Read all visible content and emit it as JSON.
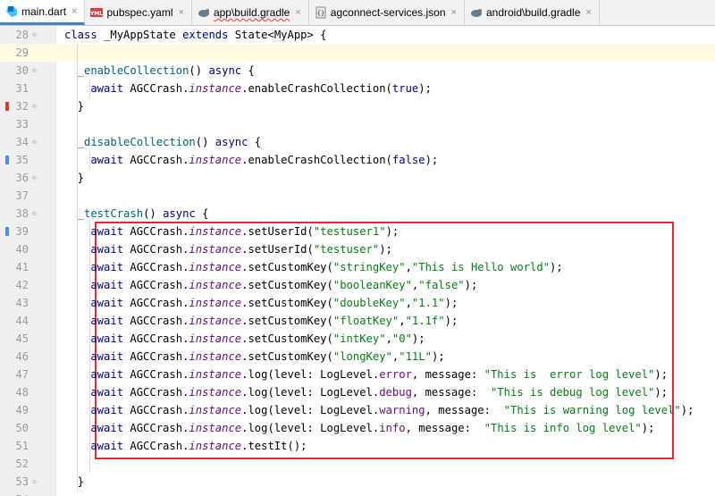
{
  "tabs": [
    {
      "label": "main.dart",
      "icon": "dart-file-icon",
      "active": true,
      "error": false
    },
    {
      "label": "pubspec.yaml",
      "icon": "yaml-file-icon",
      "active": false,
      "error": false
    },
    {
      "label": "app\\build.gradle",
      "icon": "gradle-file-icon",
      "active": false,
      "error": true
    },
    {
      "label": "agconnect-services.json",
      "icon": "json-file-icon",
      "active": false,
      "error": false
    },
    {
      "label": "android\\build.gradle",
      "icon": "gradle-file-icon",
      "active": false,
      "error": false
    }
  ],
  "tab_close_glyph": "×",
  "yml_badge": "YML",
  "lines": [
    {
      "n": "28",
      "tokens": [
        [
          "class ",
          "kw"
        ],
        [
          "_MyAppState ",
          ""
        ],
        [
          "extends ",
          "kw"
        ],
        [
          "State<MyApp> {",
          ""
        ]
      ]
    },
    {
      "n": "29",
      "tokens": [],
      "current": true
    },
    {
      "n": "30",
      "tokens": [
        [
          "  _enableCollection",
          "fn"
        ],
        [
          "() ",
          ""
        ],
        [
          "async ",
          "kw"
        ],
        [
          "{",
          ""
        ]
      ]
    },
    {
      "n": "31",
      "tokens": [
        [
          "    await ",
          "kw"
        ],
        [
          "AGCCrash.",
          ""
        ],
        [
          "instance",
          "it"
        ],
        [
          ".enableCrashCollection(",
          ""
        ],
        [
          "true",
          "kw"
        ],
        [
          ");",
          ""
        ]
      ]
    },
    {
      "n": "32",
      "tokens": [
        [
          "  }",
          ""
        ]
      ]
    },
    {
      "n": "33",
      "tokens": []
    },
    {
      "n": "34",
      "tokens": [
        [
          "  _disableCollection",
          "fn"
        ],
        [
          "() ",
          ""
        ],
        [
          "async ",
          "kw"
        ],
        [
          "{",
          ""
        ]
      ]
    },
    {
      "n": "35",
      "tokens": [
        [
          "    await ",
          "kw"
        ],
        [
          "AGCCrash.",
          ""
        ],
        [
          "instance",
          "it"
        ],
        [
          ".enableCrashCollection(",
          ""
        ],
        [
          "false",
          "kw"
        ],
        [
          ");",
          ""
        ]
      ]
    },
    {
      "n": "36",
      "tokens": [
        [
          "  }",
          ""
        ]
      ]
    },
    {
      "n": "37",
      "tokens": []
    },
    {
      "n": "38",
      "tokens": [
        [
          "  _testCrash",
          "fn"
        ],
        [
          "() ",
          ""
        ],
        [
          "async ",
          "kw"
        ],
        [
          "{",
          ""
        ]
      ]
    },
    {
      "n": "39",
      "tokens": [
        [
          "    await ",
          "kw"
        ],
        [
          "AGCCrash.",
          ""
        ],
        [
          "instance",
          "it"
        ],
        [
          ".setUserId(",
          ""
        ],
        [
          "\"testuser1\"",
          "str"
        ],
        [
          ");",
          ""
        ]
      ]
    },
    {
      "n": "40",
      "tokens": [
        [
          "    await ",
          "kw"
        ],
        [
          "AGCCrash.",
          ""
        ],
        [
          "instance",
          "it"
        ],
        [
          ".setUserId(",
          ""
        ],
        [
          "\"testuser\"",
          "str"
        ],
        [
          ");",
          ""
        ]
      ]
    },
    {
      "n": "41",
      "tokens": [
        [
          "    await ",
          "kw"
        ],
        [
          "AGCCrash.",
          ""
        ],
        [
          "instance",
          "it"
        ],
        [
          ".setCustomKey(",
          ""
        ],
        [
          "\"stringKey\"",
          "str"
        ],
        [
          ",",
          ""
        ],
        [
          "\"This is Hello world\"",
          "str"
        ],
        [
          ");",
          ""
        ]
      ]
    },
    {
      "n": "42",
      "tokens": [
        [
          "    await ",
          "kw"
        ],
        [
          "AGCCrash.",
          ""
        ],
        [
          "instance",
          "it"
        ],
        [
          ".setCustomKey(",
          ""
        ],
        [
          "\"booleanKey\"",
          "str"
        ],
        [
          ",",
          ""
        ],
        [
          "\"false\"",
          "str"
        ],
        [
          ");",
          ""
        ]
      ]
    },
    {
      "n": "43",
      "tokens": [
        [
          "    await ",
          "kw"
        ],
        [
          "AGCCrash.",
          ""
        ],
        [
          "instance",
          "it"
        ],
        [
          ".setCustomKey(",
          ""
        ],
        [
          "\"doubleKey\"",
          "str"
        ],
        [
          ",",
          ""
        ],
        [
          "\"1.1\"",
          "str"
        ],
        [
          ");",
          ""
        ]
      ]
    },
    {
      "n": "44",
      "tokens": [
        [
          "    await ",
          "kw"
        ],
        [
          "AGCCrash.",
          ""
        ],
        [
          "instance",
          "it"
        ],
        [
          ".setCustomKey(",
          ""
        ],
        [
          "\"floatKey\"",
          "str"
        ],
        [
          ",",
          ""
        ],
        [
          "\"1.1f\"",
          "str"
        ],
        [
          ");",
          ""
        ]
      ]
    },
    {
      "n": "45",
      "tokens": [
        [
          "    await ",
          "kw"
        ],
        [
          "AGCCrash.",
          ""
        ],
        [
          "instance",
          "it"
        ],
        [
          ".setCustomKey(",
          ""
        ],
        [
          "\"intKey\"",
          "str"
        ],
        [
          ",",
          ""
        ],
        [
          "\"0\"",
          "str"
        ],
        [
          ");",
          ""
        ]
      ]
    },
    {
      "n": "46",
      "tokens": [
        [
          "    await ",
          "kw"
        ],
        [
          "AGCCrash.",
          ""
        ],
        [
          "instance",
          "it"
        ],
        [
          ".setCustomKey(",
          ""
        ],
        [
          "\"longKey\"",
          "str"
        ],
        [
          ",",
          ""
        ],
        [
          "\"11L\"",
          "str"
        ],
        [
          ");",
          ""
        ]
      ]
    },
    {
      "n": "47",
      "tokens": [
        [
          "    await ",
          "kw"
        ],
        [
          "AGCCrash.",
          ""
        ],
        [
          "instance",
          "it"
        ],
        [
          ".log(level: LogLevel.",
          ""
        ],
        [
          "error",
          "fld"
        ],
        [
          ", message: ",
          ""
        ],
        [
          "\"This is  error log level\"",
          "str"
        ],
        [
          ");",
          ""
        ]
      ]
    },
    {
      "n": "48",
      "tokens": [
        [
          "    await ",
          "kw"
        ],
        [
          "AGCCrash.",
          ""
        ],
        [
          "instance",
          "it"
        ],
        [
          ".log(level: LogLevel.",
          ""
        ],
        [
          "debug",
          "fld"
        ],
        [
          ", message:  ",
          ""
        ],
        [
          "\"This is debug log level\"",
          "str"
        ],
        [
          ");",
          ""
        ]
      ]
    },
    {
      "n": "49",
      "tokens": [
        [
          "    await ",
          "kw"
        ],
        [
          "AGCCrash.",
          ""
        ],
        [
          "instance",
          "it"
        ],
        [
          ".log(level: LogLevel.",
          ""
        ],
        [
          "warning",
          "fld"
        ],
        [
          ", message:  ",
          ""
        ],
        [
          "\"This is warning log level\"",
          "str"
        ],
        [
          ");",
          ""
        ]
      ]
    },
    {
      "n": "50",
      "tokens": [
        [
          "    await ",
          "kw"
        ],
        [
          "AGCCrash.",
          ""
        ],
        [
          "instance",
          "it"
        ],
        [
          ".log(level: LogLevel.",
          ""
        ],
        [
          "info",
          "fld"
        ],
        [
          ", message:  ",
          ""
        ],
        [
          "\"This is info log level\"",
          "str"
        ],
        [
          ");",
          ""
        ]
      ]
    },
    {
      "n": "51",
      "tokens": [
        [
          "    await ",
          "kw"
        ],
        [
          "AGCCrash.",
          ""
        ],
        [
          "instance",
          "it"
        ],
        [
          ".testIt();",
          ""
        ]
      ]
    },
    {
      "n": "52",
      "tokens": []
    },
    {
      "n": "53",
      "tokens": [
        [
          "  }",
          ""
        ]
      ]
    },
    {
      "n": "54",
      "tokens": []
    }
  ],
  "gutter_markers": [
    {
      "line": "32",
      "color": "#e53935"
    },
    {
      "line": "35",
      "color": "#4c8cf0"
    },
    {
      "line": "39",
      "color": "#4c8cf0"
    }
  ],
  "highlight_box_color": "#e8282f"
}
